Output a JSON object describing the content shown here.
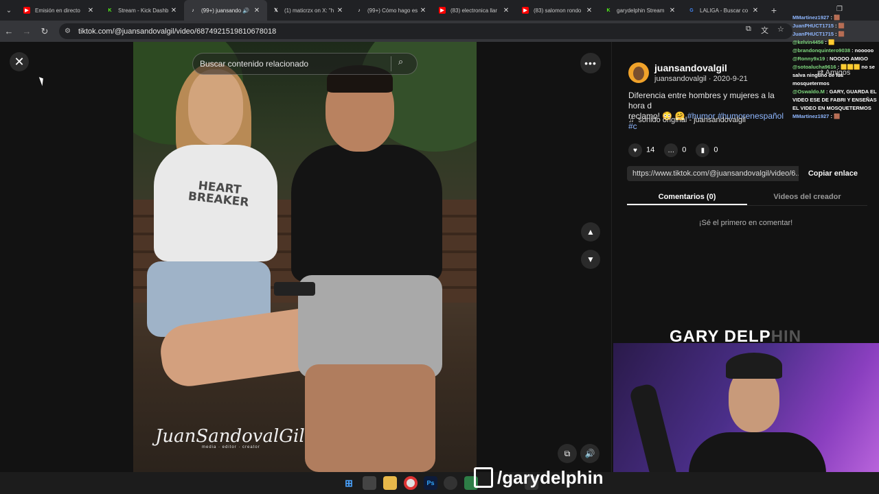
{
  "browser": {
    "tabs": [
      {
        "title": "Emisión en directo",
        "favicon": "youtube-icon",
        "color": "#ff0000"
      },
      {
        "title": "Stream - Kick Dashb",
        "favicon": "kick-icon",
        "color": "#53fc18"
      },
      {
        "title": "(99+) juansando",
        "favicon": "tiktok-icon",
        "color": "#ffffff",
        "active": true
      },
      {
        "title": "(1) maticrzx on X: \"h",
        "favicon": "x-icon",
        "color": "#ffffff"
      },
      {
        "title": "(99+) Cómo hago es",
        "favicon": "tiktok-icon",
        "color": "#ffffff"
      },
      {
        "title": "(83) electronica llar",
        "favicon": "youtube-icon",
        "color": "#ff0000"
      },
      {
        "title": "(83) salomon rondo",
        "favicon": "youtube-icon",
        "color": "#ff0000"
      },
      {
        "title": "garydelphin Stream",
        "favicon": "kick-icon",
        "color": "#53fc18"
      },
      {
        "title": "LALIGA - Buscar co",
        "favicon": "google-icon",
        "color": "#4285f4"
      }
    ],
    "url": "tiktok.com/@juansandovalgil/video/6874921519810678018"
  },
  "video": {
    "search_placeholder": "Buscar contenido relacionado",
    "shirt_print": "HEART BREAKER",
    "watermark": "JuanSandovalGil",
    "watermark_sub": "media · editor · creator"
  },
  "post": {
    "username": "juansandovalgil",
    "handle": "juansandovalgil",
    "date": "2020-9-21",
    "description": "Diferencia entre hombres y mujeres a la hora d",
    "description_2": "reclamo! 😳 🤗",
    "tags": "#humor #humorenespañol #c",
    "sound": "sonido original - juansandovalgil",
    "likes": "14",
    "comments": "0",
    "saves": "0",
    "link": "https://www.tiktok.com/@juansandovalgil/video/6...",
    "copy_label": "Copiar enlace",
    "tab_comments": "Comentarios (0)",
    "tab_creator": "Videos del creador",
    "empty_comments": "¡Sé el primero en comentar!"
  },
  "overlay": {
    "amigos": "Amigos",
    "chat": [
      {
        "user": "MMartinez1927",
        "msg": ": 🟫"
      },
      {
        "user": "JuanPHUCT1715",
        "msg": ": 🟫"
      },
      {
        "user": "JuanPHUCT1715",
        "msg": ": 🟫"
      },
      {
        "user": "@kelvin4456",
        "msg": ": 🟨"
      },
      {
        "user": "@brandonquintero9038",
        "msg": ": nooooo"
      },
      {
        "user": "@Ronny9x19",
        "msg": ": NOOOO AMIGO"
      },
      {
        "user": "@sotoalucha9616",
        "msg": ": 🟨🟨🟨 no se salva ninguno de los mosquetermos"
      },
      {
        "user": "@Oswaldo.M",
        "msg": ": GARY, GUARDA EL VIDEO ESE DE FABRI Y ENSEÑAS EL VIDEO EN MOSQUETERMOS"
      },
      {
        "user": "MMartinez1927",
        "msg": ": 🟫"
      }
    ],
    "cam_logo_bright": "GARY DELP",
    "cam_logo_dim": "HIN",
    "twitch_handle": "/garydelphin"
  }
}
